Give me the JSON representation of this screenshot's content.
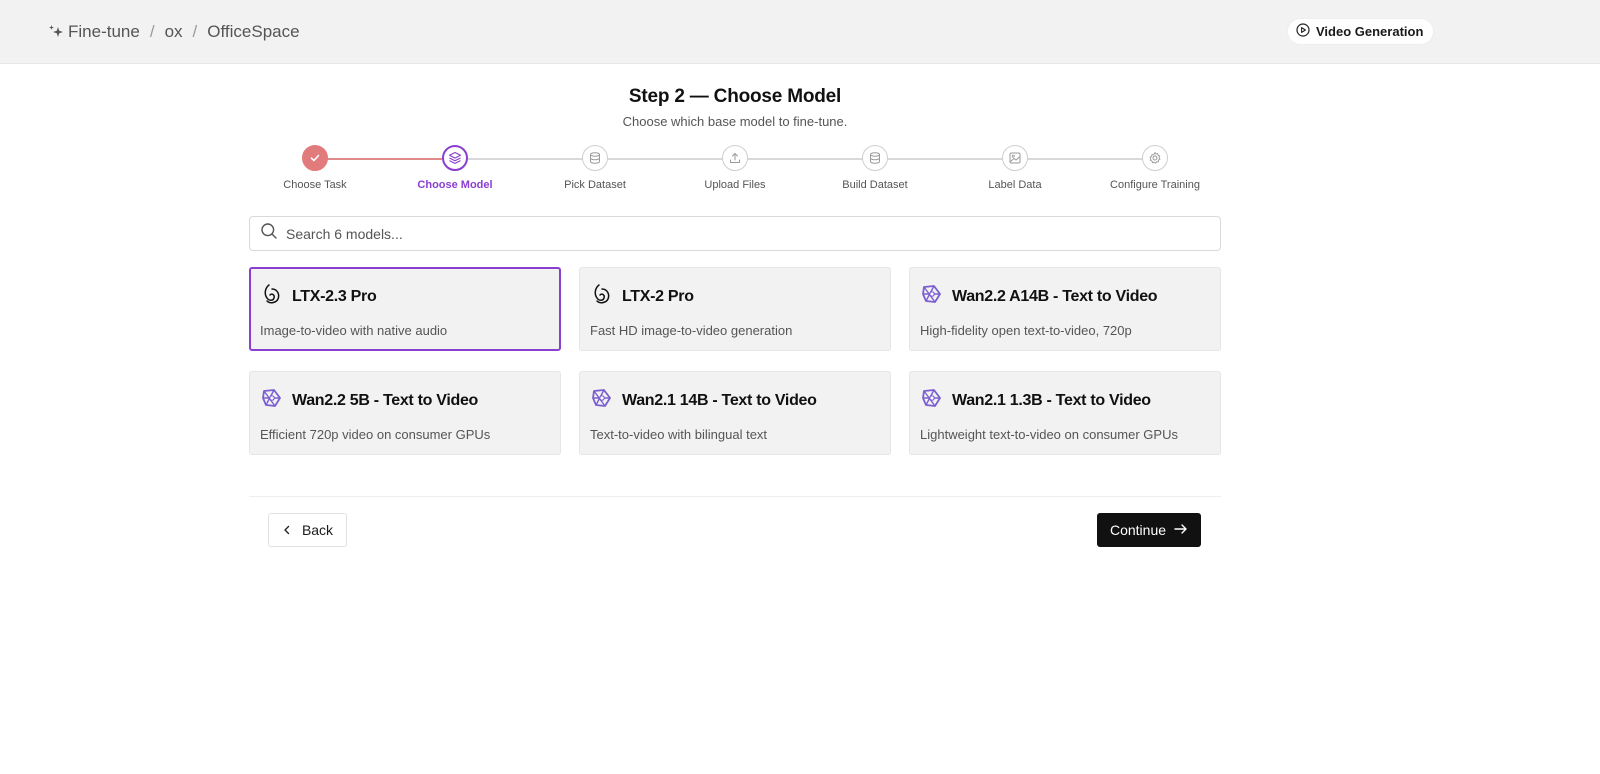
{
  "breadcrumb": {
    "items": [
      "Fine-tune",
      "ox",
      "OfficeSpace"
    ],
    "separator": "/"
  },
  "header_pill": {
    "label": "Video Generation",
    "icon": "play-circle-icon"
  },
  "page": {
    "title": "Step 2 — Choose Model",
    "subtitle": "Choose which base model to fine-tune."
  },
  "stepper": {
    "steps": [
      {
        "label": "Choose Task",
        "state": "complete",
        "icon": "check-icon"
      },
      {
        "label": "Choose Model",
        "state": "active",
        "icon": "layers-icon"
      },
      {
        "label": "Pick Dataset",
        "state": "pending",
        "icon": "database-icon"
      },
      {
        "label": "Upload Files",
        "state": "pending",
        "icon": "upload-icon"
      },
      {
        "label": "Build Dataset",
        "state": "pending",
        "icon": "database-icon"
      },
      {
        "label": "Label Data",
        "state": "pending",
        "icon": "image-icon"
      },
      {
        "label": "Configure Training",
        "state": "pending",
        "icon": "gear-icon"
      }
    ]
  },
  "search": {
    "placeholder": "Search 6 models...",
    "value": ""
  },
  "models": [
    {
      "name": "LTX-2.3 Pro",
      "description": "Image-to-video with native audio",
      "icon": "ltx-logo-icon",
      "selected": true
    },
    {
      "name": "LTX-2 Pro",
      "description": "Fast HD image-to-video generation",
      "icon": "ltx-logo-icon",
      "selected": false
    },
    {
      "name": "Wan2.2 A14B - Text to Video",
      "description": "High-fidelity open text-to-video, 720p",
      "icon": "wan-logo-icon",
      "selected": false
    },
    {
      "name": "Wan2.2 5B - Text to Video",
      "description": "Efficient 720p video on consumer GPUs",
      "icon": "wan-logo-icon",
      "selected": false
    },
    {
      "name": "Wan2.1 14B - Text to Video",
      "description": "Text-to-video with bilingual text",
      "icon": "wan-logo-icon",
      "selected": false
    },
    {
      "name": "Wan2.1 1.3B - Text to Video",
      "description": "Lightweight text-to-video on consumer GPUs",
      "icon": "wan-logo-icon",
      "selected": false
    }
  ],
  "footer": {
    "back_label": "Back",
    "continue_label": "Continue"
  },
  "colors": {
    "accent": "#8a3fd1",
    "complete": "#e27b7b",
    "primary_button": "#111111"
  }
}
